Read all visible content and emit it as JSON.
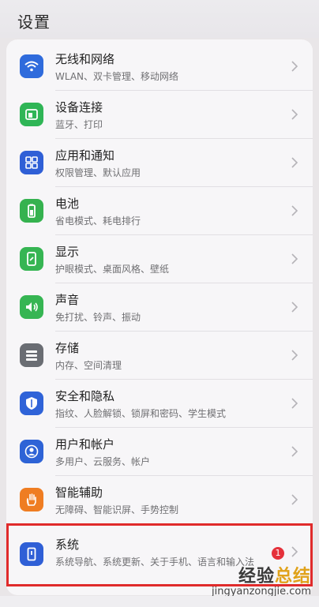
{
  "header": {
    "title": "设置"
  },
  "settings": [
    {
      "title": "无线和网络",
      "subtitle": "WLAN、双卡管理、移动网络",
      "icon": "wifi-icon",
      "color": "#2f6bdc"
    },
    {
      "title": "设备连接",
      "subtitle": "蓝牙、打印",
      "icon": "device-connection-icon",
      "color": "#2fb556"
    },
    {
      "title": "应用和通知",
      "subtitle": "权限管理、默认应用",
      "icon": "apps-icon",
      "color": "#2f5fd6"
    },
    {
      "title": "电池",
      "subtitle": "省电模式、耗电排行",
      "icon": "battery-icon",
      "color": "#35b24f"
    },
    {
      "title": "显示",
      "subtitle": "护眼模式、桌面风格、壁纸",
      "icon": "display-icon",
      "color": "#36b553"
    },
    {
      "title": "声音",
      "subtitle": "免打扰、铃声、振动",
      "icon": "sound-icon",
      "color": "#36b553"
    },
    {
      "title": "存储",
      "subtitle": "内存、空间清理",
      "icon": "storage-icon",
      "color": "#6a6d73"
    },
    {
      "title": "安全和隐私",
      "subtitle": "指纹、人脸解锁、锁屏和密码、学生模式",
      "icon": "shield-icon",
      "color": "#2f63d8"
    },
    {
      "title": "用户和帐户",
      "subtitle": "多用户、云服务、帐户",
      "icon": "user-icon",
      "color": "#2e63d6"
    },
    {
      "title": "智能辅助",
      "subtitle": "无障碍、智能识屏、手势控制",
      "icon": "hand-icon",
      "color": "#ef7d22"
    },
    {
      "title": "系统",
      "subtitle": "系统导航、系统更新、关于手机、语言和输入法",
      "icon": "system-phone-icon",
      "color": "#2f5fd6",
      "badge": "1"
    }
  ],
  "watermark": {
    "text_main": "经验",
    "text_accent": "总结",
    "url": "jingyanzongjie.com"
  },
  "colors": {
    "highlight": "#e02b2b",
    "badge": "#e5313b"
  }
}
